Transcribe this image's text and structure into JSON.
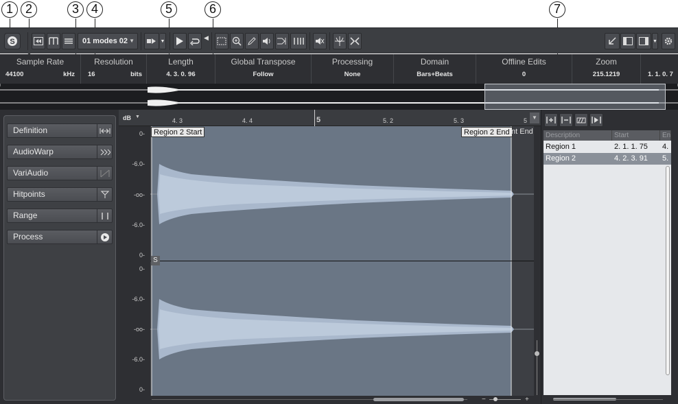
{
  "callouts": [
    "1",
    "2",
    "3",
    "4",
    "5",
    "6",
    "7"
  ],
  "toolbar": {
    "preset": "01 modes 02"
  },
  "infoline": [
    {
      "label": "Sample Rate",
      "value": "44100",
      "unit": "kHz"
    },
    {
      "label": "Resolution",
      "value": "16",
      "unit": "bits"
    },
    {
      "label": "Length",
      "value": "4. 3. 0. 96"
    },
    {
      "label": "Global Transpose",
      "value": "Follow"
    },
    {
      "label": "Processing",
      "value": "None"
    },
    {
      "label": "Domain",
      "value": "Bars+Beats"
    },
    {
      "label": "Offline Edits",
      "value": "0"
    },
    {
      "label": "Zoom",
      "value": "215.1219"
    },
    {
      "label": "",
      "value": "1. 1. 0. 7"
    }
  ],
  "inspector": {
    "tabs": [
      {
        "label": "Definition",
        "icon": "definition-icon"
      },
      {
        "label": "AudioWarp",
        "icon": "audiowarp-icon"
      },
      {
        "label": "VariAudio",
        "icon": "variaudio-icon"
      },
      {
        "label": "Hitpoints",
        "icon": "hitpoints-icon"
      },
      {
        "label": "Range",
        "icon": "range-icon"
      },
      {
        "label": "Process",
        "icon": "process-icon"
      }
    ]
  },
  "ruler": {
    "unit_label": "dB",
    "ticks": [
      "4. 3",
      "4. 4",
      "5",
      "5. 2",
      "5. 3",
      "5"
    ]
  },
  "db_scale": [
    "0-",
    "-6.0-",
    "-oo-",
    "-6.0-",
    "0-",
    "0-",
    "-6.0-",
    "-oo-",
    "-6.0-",
    "0-"
  ],
  "markers": {
    "start": "Region 2 Start",
    "end": "Region 2 End",
    "end_trunc": "nt End"
  },
  "s_tag": "S",
  "regions": {
    "columns": [
      "Description",
      "Start",
      "End"
    ],
    "rows": [
      {
        "description": "Region 1",
        "start": "2. 1. 1. 75",
        "end": "4.",
        "selected": false
      },
      {
        "description": "Region 2",
        "start": "4. 2. 3. 91",
        "end": "5.",
        "selected": true
      }
    ]
  },
  "colors": {
    "waveform": "#9fb0c8",
    "region_bg": "#6a7685",
    "panel_bg": "#2e2f33"
  }
}
